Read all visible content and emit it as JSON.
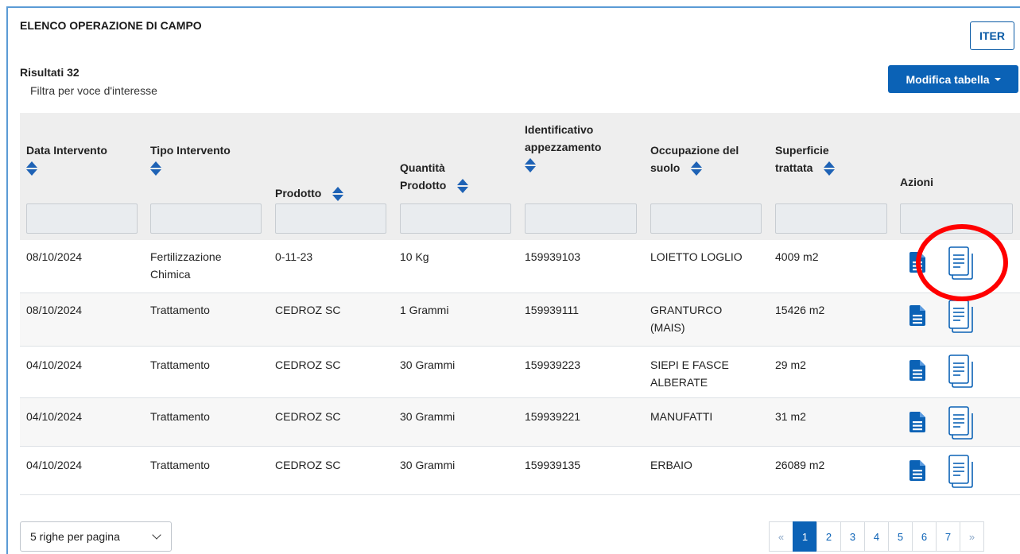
{
  "header": {
    "title": "ELENCO OPERAZIONE DI CAMPO",
    "iter_label": "ITER",
    "results_label": "Risultati 32",
    "filter_hint": "Filtra per voce d'interesse",
    "modifica_label": "Modifica tabella"
  },
  "columns": {
    "data": [
      "Data Intervento"
    ],
    "tipo": [
      "Tipo Intervento"
    ],
    "prodotto": [
      "Prodotto"
    ],
    "quantita": [
      "Quantità",
      "Prodotto"
    ],
    "identificativo": [
      "Identificativo",
      "appezzamento"
    ],
    "occupazione": [
      "Occupazione del",
      "suolo"
    ],
    "superficie": [
      "Superficie",
      "trattata"
    ],
    "azioni": "Azioni"
  },
  "rows": [
    {
      "data": "08/10/2024",
      "tipo": [
        "Fertilizzazione",
        "Chimica"
      ],
      "prodotto": "0-11-23",
      "quantita": "10 Kg",
      "id": "159939103",
      "occupazione": [
        "LOIETTO LOGLIO"
      ],
      "superficie": "4009 m2"
    },
    {
      "data": "08/10/2024",
      "tipo": [
        "Trattamento"
      ],
      "prodotto": "CEDROZ SC",
      "quantita": "1 Grammi",
      "id": "159939111",
      "occupazione": [
        "GRANTURCO",
        "(MAIS)"
      ],
      "superficie": "15426 m2"
    },
    {
      "data": "04/10/2024",
      "tipo": [
        "Trattamento"
      ],
      "prodotto": "CEDROZ SC",
      "quantita": "30 Grammi",
      "id": "159939223",
      "occupazione": [
        "SIEPI E FASCE",
        "ALBERATE"
      ],
      "superficie": "29 m2"
    },
    {
      "data": "04/10/2024",
      "tipo": [
        "Trattamento"
      ],
      "prodotto": "CEDROZ SC",
      "quantita": "30 Grammi",
      "id": "159939221",
      "occupazione": [
        "MANUFATTI"
      ],
      "superficie": "31 m2"
    },
    {
      "data": "04/10/2024",
      "tipo": [
        "Trattamento"
      ],
      "prodotto": "CEDROZ SC",
      "quantita": "30 Grammi",
      "id": "159939135",
      "occupazione": [
        "ERBAIO"
      ],
      "superficie": "26089 m2"
    }
  ],
  "footer": {
    "rows_per_page": "5 righe per pagina",
    "pages": [
      "«",
      "1",
      "2",
      "3",
      "4",
      "5",
      "6",
      "7",
      "»"
    ],
    "active_page": "1"
  },
  "colors": {
    "accent": "#0b62b6",
    "highlight_circle": "#ff0000"
  },
  "icons": [
    "document-solid-icon",
    "document-copy-icon",
    "sort-icon",
    "chevron-down-icon"
  ]
}
